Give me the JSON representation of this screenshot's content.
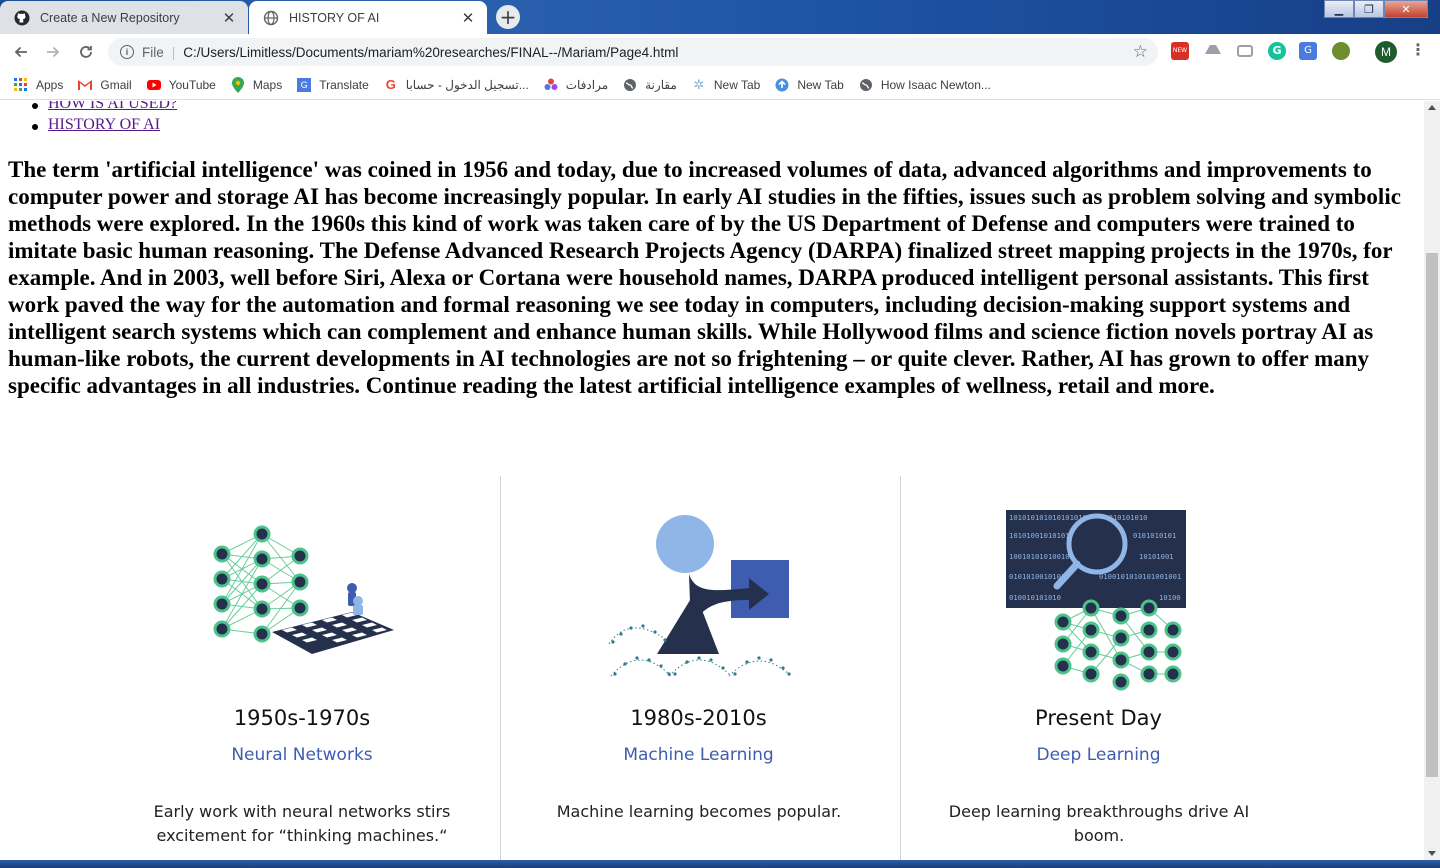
{
  "browser": {
    "tabs": [
      {
        "title": "Create a New Repository",
        "icon": "github-icon",
        "active": false
      },
      {
        "title": "HISTORY OF AI",
        "icon": "globe-icon",
        "active": true
      }
    ],
    "address": {
      "scheme_label": "File",
      "url": "C:/Users/Limitless/Documents/mariam%20researches/FINAL--/Mariam/Page4.html"
    },
    "profile_initial": "M",
    "bookmarks": [
      {
        "label": "Apps",
        "icon": "apps-grid-icon"
      },
      {
        "label": "Gmail",
        "icon": "gmail-icon"
      },
      {
        "label": "YouTube",
        "icon": "youtube-icon"
      },
      {
        "label": "Maps",
        "icon": "maps-pin-icon"
      },
      {
        "label": "Translate",
        "icon": "translate-icon"
      },
      {
        "label": "تسجيل الدخول - حسابا...",
        "icon": "google-icon"
      },
      {
        "label": "مرادفات",
        "icon": "flower-icon"
      },
      {
        "label": "مقارنة",
        "icon": "globe-icon"
      },
      {
        "label": "New Tab",
        "icon": "gear-icon"
      },
      {
        "label": "New Tab",
        "icon": "upload-icon"
      },
      {
        "label": "How Isaac Newton...",
        "icon": "globe-icon"
      }
    ]
  },
  "page": {
    "nav_links": [
      "HOW IS AI USED?",
      "HISTORY OF AI"
    ],
    "intro": "The term 'artificial intelligence' was coined in 1956 and today, due to increased volumes of data, advanced algorithms and improvements to computer power and storage AI has become increasingly popular. In early AI studies in the fifties, issues such as problem solving and symbolic methods were explored. In the 1960s this kind of work was taken care of by the US Department of Defense and computers were trained to imitate basic human reasoning. The Defense Advanced Research Projects Agency (DARPA) finalized street mapping projects in the 1970s, for example. And in 2003, well before Siri, Alexa or Cortana were household names, DARPA produced intelligent personal assistants. This first work paved the way for the automation and formal reasoning we see today in computers, including decision-making support systems and intelligent search systems which can complement and enhance human skills. While Hollywood films and science fiction novels portray AI as human-like robots, the current developments in AI technologies are not so frightening – or quite clever. Rather, AI has grown to offer many specific advantages in all industries. Continue reading the latest artificial intelligence examples of wellness, retail and more.",
    "timeline": [
      {
        "era": "1950s-1970s",
        "topic": "Neural Networks",
        "desc": "Early work with neural networks stirs excitement for “thinking machines.“"
      },
      {
        "era": "1980s-2010s",
        "topic": "Machine Learning",
        "desc": "Machine learning becomes popular."
      },
      {
        "era": "Present Day",
        "topic": "Deep Learning",
        "desc": "Deep learning breakthroughs drive AI boom."
      }
    ],
    "binary_rows": [
      "10101010101010101010101010101010",
      "1010100101010101",
      "0101010101",
      "1001010101001010",
      "10101001",
      "0101010010101",
      "0100101010101001001",
      "010010101010",
      "10100"
    ]
  },
  "colors": {
    "accent_blue": "#3f5db0",
    "link_visited": "#551a8b",
    "illustration_green": "#4cc38a",
    "illustration_navy": "#25304d",
    "illustration_light_blue": "#8fb6e6"
  }
}
